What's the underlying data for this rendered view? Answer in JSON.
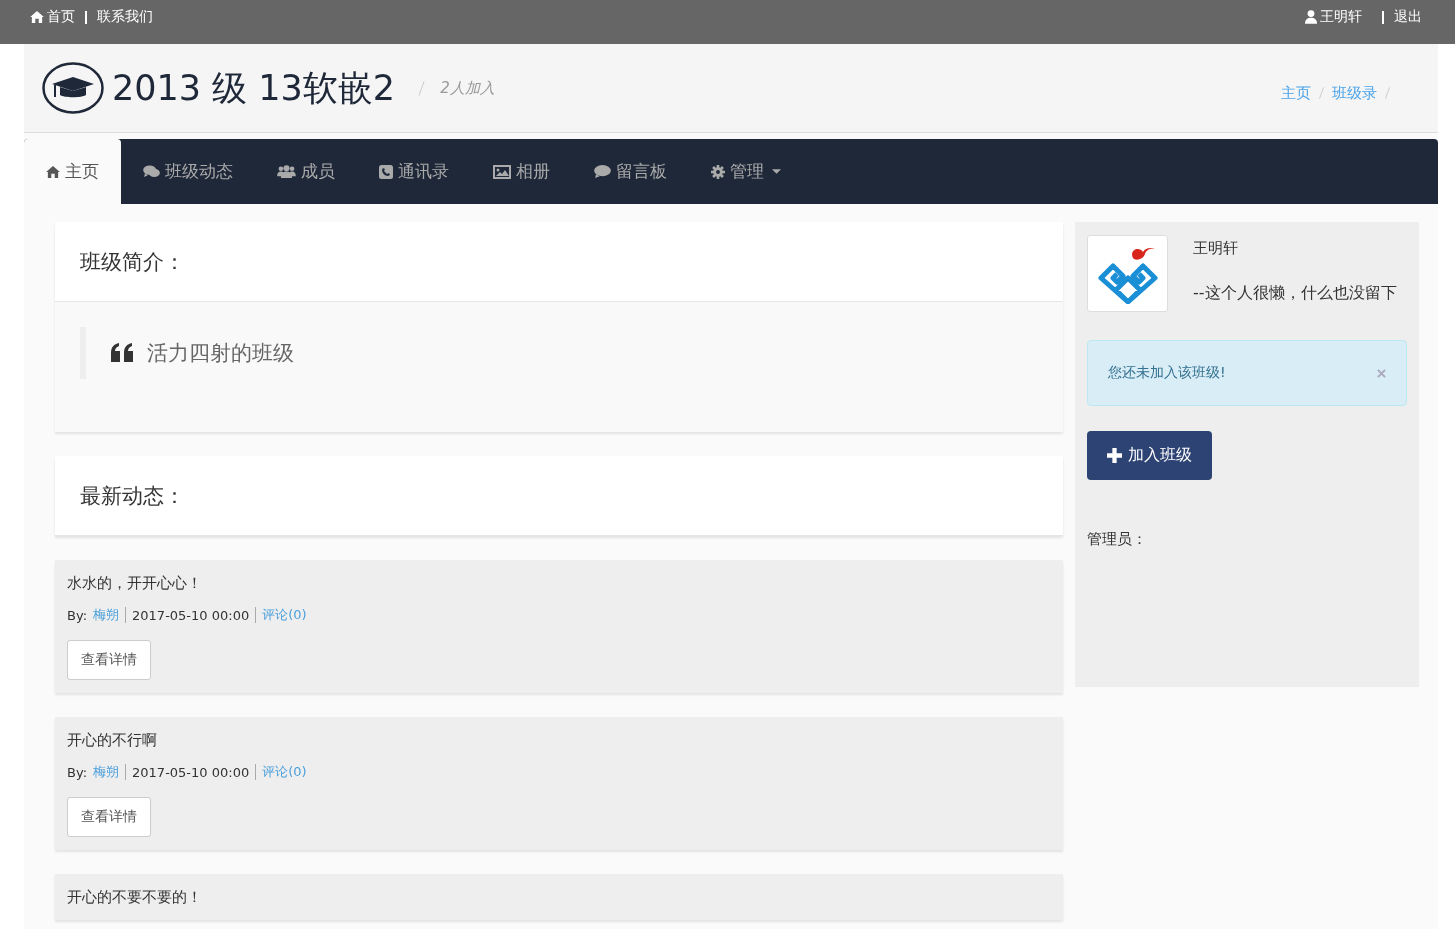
{
  "top_bar": {
    "left_links": [
      {
        "kind": "home",
        "label": "首页"
      },
      {
        "kind": "plain",
        "label": "联系我们"
      }
    ],
    "right_links": [
      {
        "kind": "user",
        "label": "王明轩"
      },
      {
        "kind": "plain",
        "label": "退出"
      }
    ]
  },
  "header": {
    "title": "2013 级 13软嵌2",
    "subtitle": "2人加入",
    "breadcrumb": [
      "主页",
      "班级录"
    ]
  },
  "tabs": [
    {
      "kind": "home",
      "label": "主页",
      "selected": true,
      "dropdown": false
    },
    {
      "kind": "comments",
      "label": "班级动态",
      "selected": false,
      "dropdown": false
    },
    {
      "kind": "users",
      "label": "成员",
      "selected": false,
      "dropdown": false
    },
    {
      "kind": "phone",
      "label": "通讯录",
      "selected": false,
      "dropdown": false
    },
    {
      "kind": "image",
      "label": "相册",
      "selected": false,
      "dropdown": false
    },
    {
      "kind": "comment",
      "label": "留言板",
      "selected": false,
      "dropdown": false
    },
    {
      "kind": "gear",
      "label": "管理",
      "selected": false,
      "dropdown": true
    }
  ],
  "intro": {
    "heading": "班级简介：",
    "quote": "活力四射的班级"
  },
  "news": {
    "heading": "最新动态：",
    "posts": [
      {
        "title": "水水的，开开心心！",
        "by_label": "By:",
        "author": "梅朔",
        "date": "2017-05-10 00:00",
        "comments": "评论(0)",
        "button": "查看详情"
      },
      {
        "title": "开心的不行啊",
        "by_label": "By:",
        "author": "梅朔",
        "date": "2017-05-10 00:00",
        "comments": "评论(0)",
        "button": "查看详情"
      },
      {
        "title": "开心的不要不要的！"
      }
    ]
  },
  "sidebar": {
    "name": "王明轩",
    "bio": "--这个人很懒，什么也没留下",
    "alert": "您还未加入该班级!",
    "join_button": "加入班级",
    "admins_label": "管理员："
  }
}
